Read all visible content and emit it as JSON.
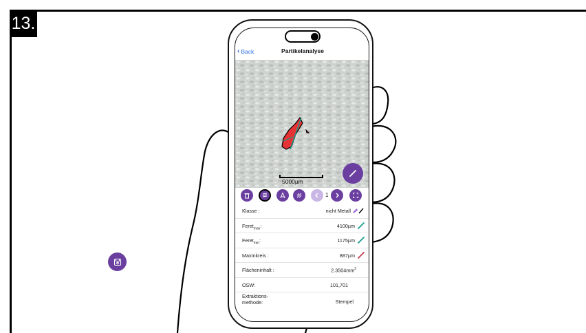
{
  "step_label": "13.",
  "app": {
    "back_label": "Back",
    "title": "Partikelanalyse"
  },
  "image": {
    "scale_label": "5000µm"
  },
  "toolbar": {
    "particle_index": "1"
  },
  "properties": [
    {
      "label": "Klasse :",
      "value": "nicht Metall",
      "icon": "pencil-purple-icon",
      "icon_color": "#9a63d6"
    },
    {
      "label": "Feret",
      "label_sub": "max",
      "label_suffix": ":",
      "value": "4100µm",
      "icon": "line-teal-icon",
      "icon_color": "#1a9e8f"
    },
    {
      "label": "Feret",
      "label_sub": "min",
      "label_suffix": ":",
      "value": "1175µm",
      "icon": "line-teal-icon",
      "icon_color": "#1a9e8f"
    },
    {
      "label": "MaxInkreis :",
      "value": "887µm",
      "icon": "line-red-icon",
      "icon_color": "#c93c4f"
    },
    {
      "label": "Flächeninhalt :",
      "value": "2.3504mm",
      "value_sup": "2"
    },
    {
      "label": "OSW:",
      "value": "101,701"
    },
    {
      "label": "Extraktions-methode:",
      "value": "Stempel"
    }
  ],
  "colors": {
    "accent": "#6a3fa0",
    "accent_light": "#c9b6e4",
    "link": "#2f6fe0",
    "particle": "#e53335"
  }
}
